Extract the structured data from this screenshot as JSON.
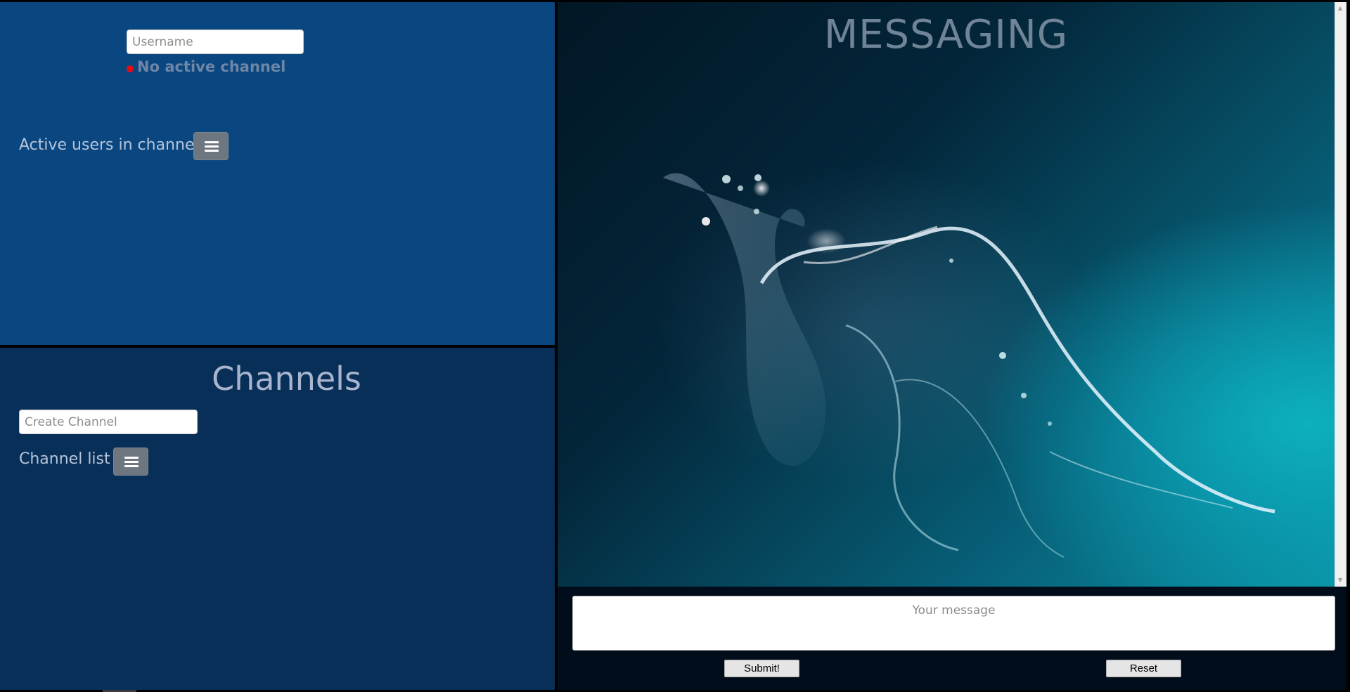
{
  "user_panel": {
    "username_placeholder": "Username",
    "status_text": "No active channel",
    "status_color": "#e01010",
    "active_users_label": "Active users in channel",
    "menu_icon": "hamburger-menu-icon"
  },
  "channels_panel": {
    "title": "Channels",
    "create_placeholder": "Create Channel",
    "channel_list_label": "Channel list",
    "menu_icon": "hamburger-menu-icon"
  },
  "messaging_panel": {
    "title": "MESSAGING",
    "background": "abstract-light-swirl-artwork"
  },
  "composer": {
    "message_placeholder": "Your message",
    "submit_label": "Submit!",
    "reset_label": "Reset"
  },
  "colors": {
    "user_panel_bg": "#0a4780",
    "channels_panel_bg": "#082f57",
    "composer_bg": "#020d1b",
    "menu_button_bg": "#6e7780"
  }
}
